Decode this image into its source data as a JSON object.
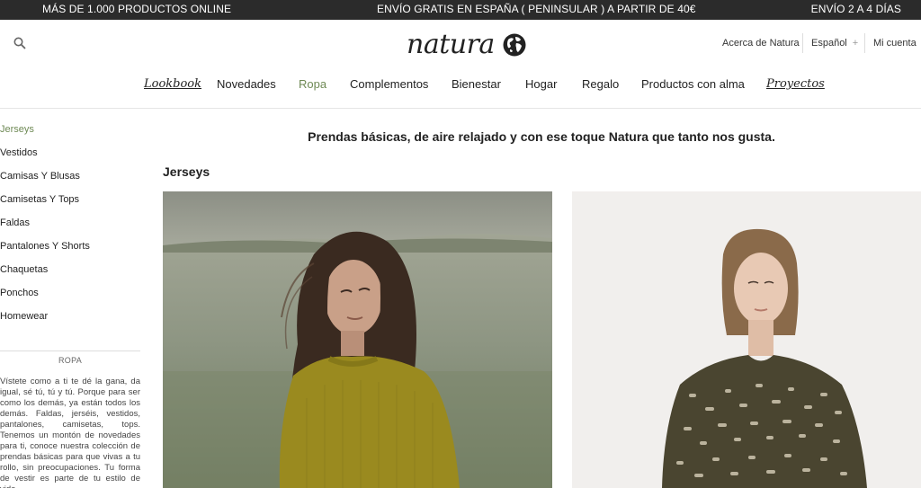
{
  "topbar": {
    "left": "MÁS DE 1.000 PRODUCTOS ONLINE",
    "center": "ENVÍO GRATIS EN ESPAÑA ( PENINSULAR ) A PARTIR DE 40€",
    "right": "ENVÍO 2 A 4 DÍAS"
  },
  "header": {
    "logo_text": "natura",
    "utility": {
      "about": "Acerca de Natura",
      "language": "Español",
      "language_toggle": "+",
      "account": "Mi cuenta"
    }
  },
  "nav": {
    "items": [
      "Lookbook",
      "Novedades",
      "Ropa",
      "Complementos",
      "Bienestar",
      "Hogar",
      "Regalo",
      "Productos con alma",
      "Proyectos"
    ],
    "active": "Ropa"
  },
  "sidebar": {
    "categories": [
      "Jerseys",
      "Vestidos",
      "Camisas Y Blusas",
      "Camisetas Y Tops",
      "Faldas",
      "Pantalones Y Shorts",
      "Chaquetas",
      "Ponchos",
      "Homewear"
    ],
    "section_title": "ROPA",
    "section_text": "Vístete como a ti te dé la gana, da igual, sé tú, tú y tú. Porque para ser como los demás, ya están todos los demás. Faldas, jerséis, vestidos, pantalones, camisetas, tops. Tenemos un montón de novedades para ti, conoce nuestra colección de prendas básicas para que vivas a tu rollo, sin preocupaciones. Tu forma de vestir es parte de tu estilo de vida,"
  },
  "main": {
    "tagline": "Prendas básicas, de aire relajado y con ese toque Natura que tanto nos gusta.",
    "category_title": "Jerseys"
  },
  "colors": {
    "topbar_bg": "#2b2b2b",
    "accent_green": "#6f8a55",
    "sweater_mustard": "#9a8a1f",
    "sweater_khaki": "#4a4530"
  }
}
